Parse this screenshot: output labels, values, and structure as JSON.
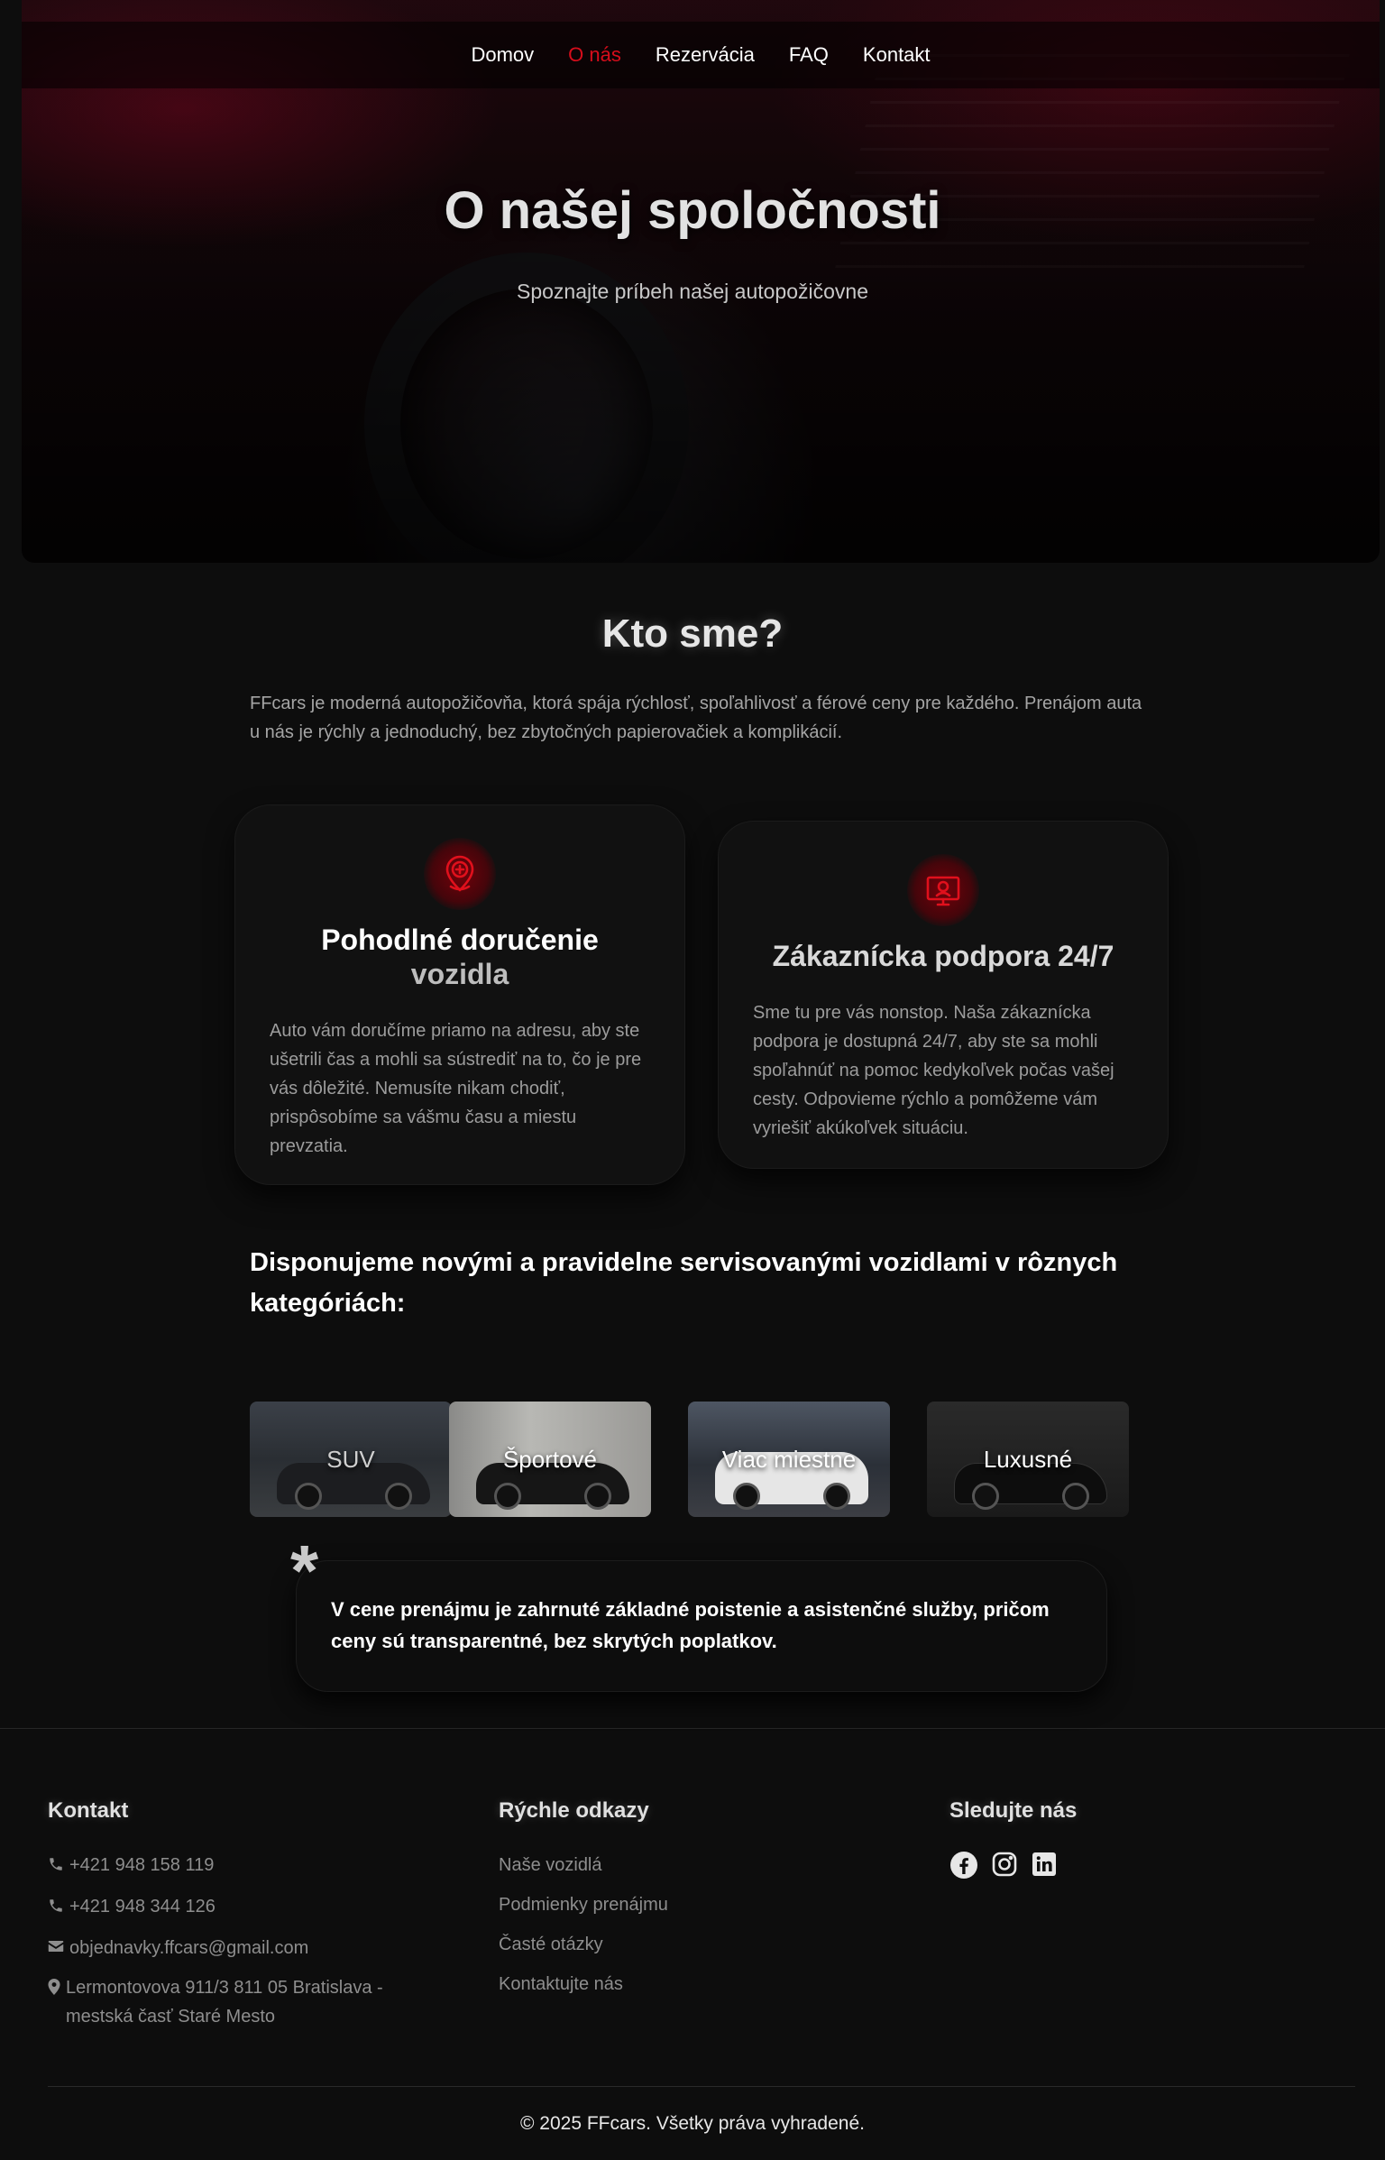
{
  "nav": {
    "items": [
      {
        "label": "Domov"
      },
      {
        "label": "O nás"
      },
      {
        "label": "Rezervácia"
      },
      {
        "label": "FAQ"
      },
      {
        "label": "Kontakt"
      }
    ],
    "active_index": 1,
    "active_color": "#d60d1b"
  },
  "hero": {
    "title": "O našej spoločnosti",
    "subtitle": "Spoznajte príbeh našej autopožičovne"
  },
  "about": {
    "title": "Kto sme?",
    "text": "FFcars je moderná autopožičovňa, ktorá spája rýchlosť, spoľahlivosť a férové ceny pre každého. Prenájom auta u nás je rýchly a jednoduchý, bez zbytočných papierovačiek a komplikácií."
  },
  "cards": [
    {
      "icon": "location-plus-icon",
      "title_line1": "Pohodlné doručenie",
      "title_line2": "vozidla",
      "text": "Auto vám doručíme priamo na adresu, aby ste ušetrili čas a mohli sa sústrediť na to, čo je pre vás dôležité. Nemusíte nikam chodiť, prispôsobíme sa vášmu času a miestu prevzatia."
    },
    {
      "icon": "support-monitor-icon",
      "title_line1": "Zákaznícka podpora 24/7",
      "text": "Sme tu pre vás nonstop. Naša zákaznícka podpora je dostupná 24/7, aby ste sa mohli spoľahnúť na pomoc kedykoľvek počas vašej cesty. Odpovieme rýchlo a pomôžeme vám vyriešiť akúkoľvek situáciu."
    }
  ],
  "fleet": {
    "title": "Disponujeme novými a pravidelne servisovanými vozidlami v rôznych kategóriách:",
    "categories": [
      {
        "label": "SUV"
      },
      {
        "label": "Športové"
      },
      {
        "label": "Viac miestne"
      },
      {
        "label": "Luxusné"
      }
    ]
  },
  "note": {
    "symbol": "*",
    "text": "V cene prenájmu je zahrnuté základné poistenie a asistenčné služby, pričom ceny sú transparentné, bez skrytých poplatkov."
  },
  "footer": {
    "contact": {
      "title": "Kontakt",
      "phone1": "+421 948 158 119",
      "phone2": "+421 948 344 126",
      "email": "objednavky.ffcars@gmail.com",
      "address": "Lermontovova 911/3 811 05 Bratislava - mestská časť Staré Mesto"
    },
    "links": {
      "title": "Rýchle odkazy",
      "items": [
        {
          "label": "Naše vozidlá"
        },
        {
          "label": "Podmienky prenájmu"
        },
        {
          "label": "Časté otázky"
        },
        {
          "label": "Kontaktujte nás"
        }
      ]
    },
    "social": {
      "title": "Sledujte nás",
      "icons": [
        "facebook-icon",
        "instagram-icon",
        "linkedin-icon"
      ]
    },
    "copyright": "© 2025 FFcars. Všetky práva vyhradené."
  }
}
